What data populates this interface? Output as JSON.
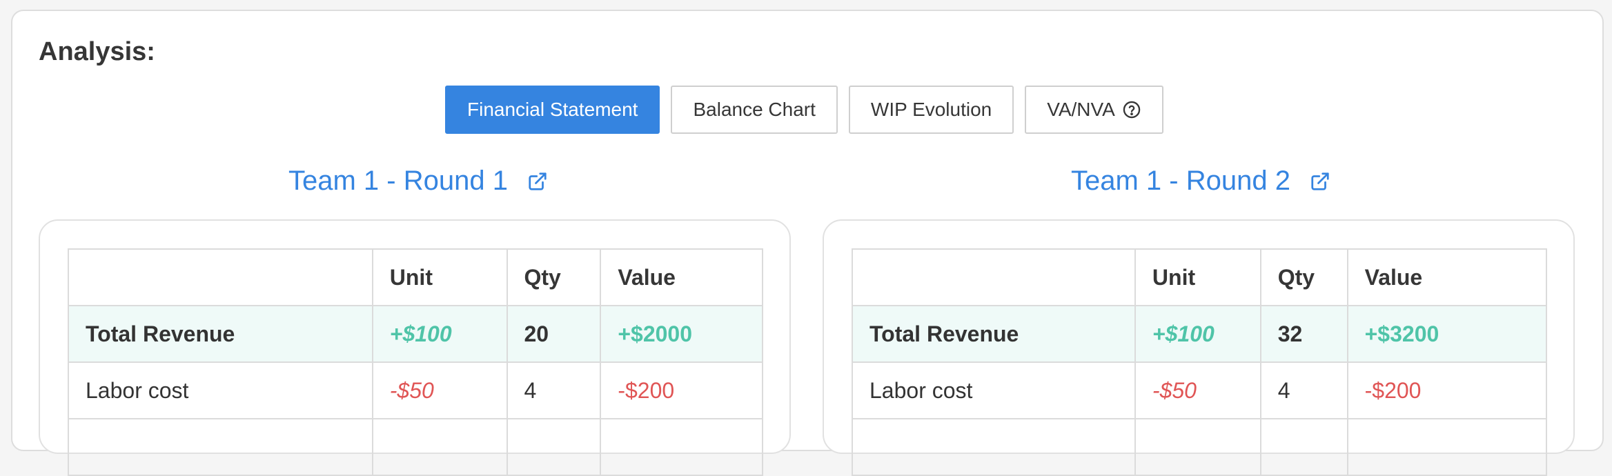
{
  "analysis_label": "Analysis:",
  "tabs": [
    {
      "label": "Financial Statement",
      "active": true
    },
    {
      "label": "Balance Chart",
      "active": false
    },
    {
      "label": "WIP Evolution",
      "active": false
    },
    {
      "label": "VA/NVA",
      "active": false
    }
  ],
  "colors": {
    "accent": "#3584e0",
    "positive": "#4fc4a8",
    "negative": "#e05555"
  },
  "headers": [
    "",
    "Unit",
    "Qty",
    "Value"
  ],
  "rounds": [
    {
      "title": "Team 1 - Round 1",
      "rows": [
        {
          "label": "Total Revenue",
          "unit": "+$100",
          "qty": "20",
          "value": "+$2000"
        },
        {
          "label": "Labor cost",
          "unit": "-$50",
          "qty": "4",
          "value": "-$200"
        }
      ]
    },
    {
      "title": "Team 1 - Round 2",
      "rows": [
        {
          "label": "Total Revenue",
          "unit": "+$100",
          "qty": "32",
          "value": "+$3200"
        },
        {
          "label": "Labor cost",
          "unit": "-$50",
          "qty": "4",
          "value": "-$200"
        }
      ]
    }
  ]
}
